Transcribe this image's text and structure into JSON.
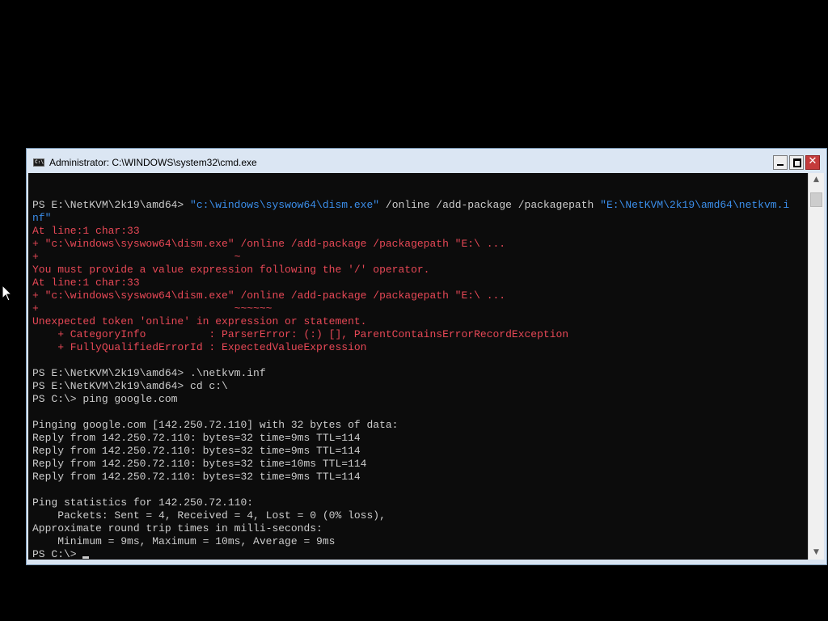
{
  "window": {
    "title": "Administrator: C:\\WINDOWS\\system32\\cmd.exe",
    "app_icon_text": "C:\\"
  },
  "controls": {
    "close_glyph": "✕",
    "scroll_up_glyph": "▲",
    "scroll_down_glyph": "▼"
  },
  "colors": {
    "console_bg": "#0c0c0c",
    "default_text": "#cccccc",
    "string_text": "#3b8eea",
    "error_text": "#e74856"
  },
  "console": {
    "lines": [
      [
        {
          "t": "PS E:\\NetKVM\\2k19\\amd64> ",
          "c": "default"
        },
        {
          "t": "\"c:\\windows\\syswow64\\dism.exe\"",
          "c": "string"
        },
        {
          "t": " /online /add-package /packagepath ",
          "c": "default"
        },
        {
          "t": "\"E:\\NetKVM\\2k19\\amd64\\netkvm.i",
          "c": "string"
        }
      ],
      [
        {
          "t": "nf\"",
          "c": "string"
        }
      ],
      [
        {
          "t": "At line:1 char:33",
          "c": "error"
        }
      ],
      [
        {
          "t": "+ \"c:\\windows\\syswow64\\dism.exe\" /online /add-package /packagepath \"E:\\ ...",
          "c": "error"
        }
      ],
      [
        {
          "t": "+                               ~",
          "c": "error"
        }
      ],
      [
        {
          "t": "You must provide a value expression following the '/' operator.",
          "c": "error"
        }
      ],
      [
        {
          "t": "At line:1 char:33",
          "c": "error"
        }
      ],
      [
        {
          "t": "+ \"c:\\windows\\syswow64\\dism.exe\" /online /add-package /packagepath \"E:\\ ...",
          "c": "error"
        }
      ],
      [
        {
          "t": "+                               ~~~~~~",
          "c": "error"
        }
      ],
      [
        {
          "t": "Unexpected token 'online' in expression or statement.",
          "c": "error"
        }
      ],
      [
        {
          "t": "    + CategoryInfo          : ParserError: (:) [], ParentContainsErrorRecordException",
          "c": "error"
        }
      ],
      [
        {
          "t": "    + FullyQualifiedErrorId : ExpectedValueExpression",
          "c": "error"
        }
      ],
      [
        {
          "t": "",
          "c": "default"
        }
      ],
      [
        {
          "t": "PS E:\\NetKVM\\2k19\\amd64> .\\netkvm.inf",
          "c": "default"
        }
      ],
      [
        {
          "t": "PS E:\\NetKVM\\2k19\\amd64> cd c:\\",
          "c": "default"
        }
      ],
      [
        {
          "t": "PS C:\\> ping google.com",
          "c": "default"
        }
      ],
      [
        {
          "t": "",
          "c": "default"
        }
      ],
      [
        {
          "t": "Pinging google.com [142.250.72.110] with 32 bytes of data:",
          "c": "default"
        }
      ],
      [
        {
          "t": "Reply from 142.250.72.110: bytes=32 time=9ms TTL=114",
          "c": "default"
        }
      ],
      [
        {
          "t": "Reply from 142.250.72.110: bytes=32 time=9ms TTL=114",
          "c": "default"
        }
      ],
      [
        {
          "t": "Reply from 142.250.72.110: bytes=32 time=10ms TTL=114",
          "c": "default"
        }
      ],
      [
        {
          "t": "Reply from 142.250.72.110: bytes=32 time=9ms TTL=114",
          "c": "default"
        }
      ],
      [
        {
          "t": "",
          "c": "default"
        }
      ],
      [
        {
          "t": "Ping statistics for 142.250.72.110:",
          "c": "default"
        }
      ],
      [
        {
          "t": "    Packets: Sent = 4, Received = 4, Lost = 0 (0% loss),",
          "c": "default"
        }
      ],
      [
        {
          "t": "Approximate round trip times in milli-seconds:",
          "c": "default"
        }
      ],
      [
        {
          "t": "    Minimum = 9ms, Maximum = 10ms, Average = 9ms",
          "c": "default"
        }
      ],
      [
        {
          "t": "PS C:\\> ",
          "c": "default"
        }
      ]
    ]
  }
}
